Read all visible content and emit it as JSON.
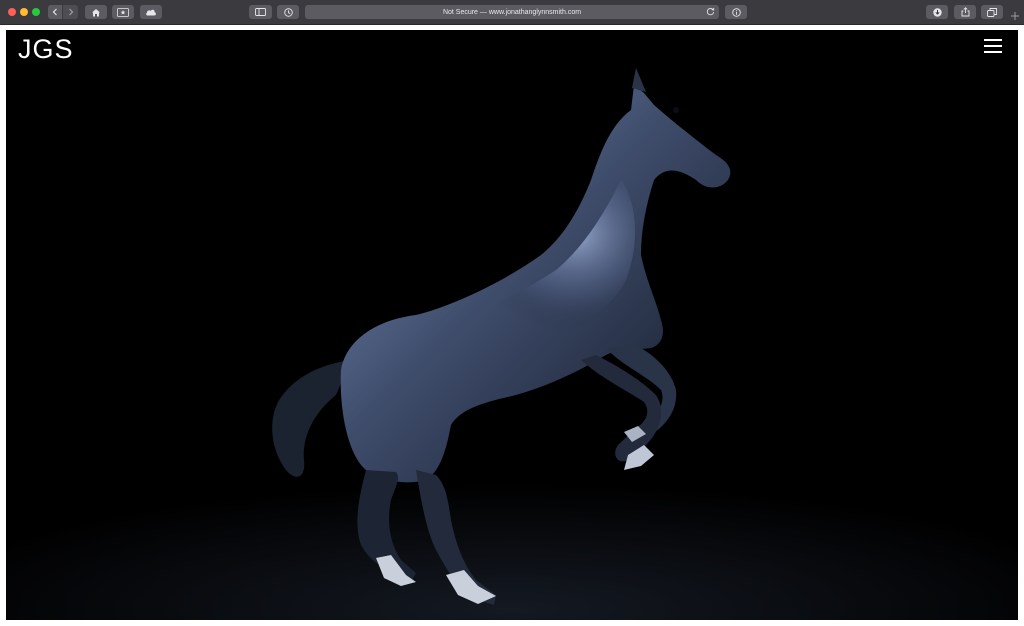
{
  "browser": {
    "address_text": "Not Secure — www.jonathanglynnsmith.com",
    "icons": {
      "back": "chevron-left-icon",
      "forward": "chevron-right-icon",
      "home": "home-icon",
      "bookmarks": "star-icon",
      "cloud": "cloud-icon",
      "sidebar": "sidebar-icon",
      "history": "clock-icon",
      "reload": "reload-icon",
      "info": "info-icon",
      "download": "download-icon",
      "share": "share-icon",
      "tabs": "tabs-icon",
      "new_tab": "plus-icon"
    },
    "colors": {
      "toolbar": "#3b3a3f",
      "button": "#5c5b61",
      "close": "#fe5f57",
      "minimize": "#febc2e",
      "zoom": "#28c840"
    }
  },
  "site": {
    "logo": "JGS",
    "menu_icon": "hamburger-menu-icon",
    "hero_image": "black-horse-rearing-photo",
    "colors": {
      "background": "#000000",
      "horse_highlight": "#8ea4cf"
    }
  }
}
